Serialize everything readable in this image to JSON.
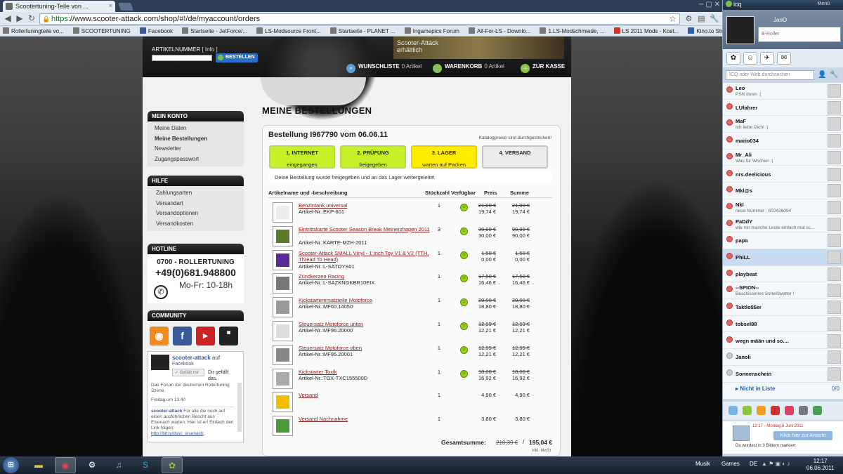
{
  "browser": {
    "tab_title": "Scootertuning-Teile von ...",
    "url_https": "https",
    "url_rest": "://www.scooter-attack.com/shop/#!/de/myaccount/orders",
    "bookmarks": [
      "Rollertuningteile vo...",
      "SCOOTERTUNING",
      "Facebook",
      "Startseite - JetForce/...",
      "LS-Modsource Front...",
      "Startseite - PLANET ...",
      "Ingamepics Forum",
      "All-For-LS - Downlo...",
      "1.LS-Modschmiede, ...",
      "LS 2011 Mods - Kost...",
      "Kino.to Stream Seite..."
    ]
  },
  "header": {
    "artikelnummer_label": "ARTIKELNUMMER",
    "info_label": "[ Info ]",
    "bestellen": "BESTELLEN",
    "banner_line1": "Scooter-Attack",
    "banner_line2": "erhältlich",
    "wishlist_label": "WUNSCHLISTE",
    "wishlist_count": "0 Artikel",
    "cart_label": "WARENKORB",
    "cart_count": "0 Artikel",
    "checkout": "ZUR KASSE"
  },
  "sidebar": {
    "account_head": "MEIN KONTO",
    "account_links": [
      "Meine Daten",
      "Meine Bestellungen",
      "Newsletter",
      "Zugangspasswort"
    ],
    "help_head": "HILFE",
    "help_links": [
      "Zahlungsarten",
      "Versandart",
      "Versandoptionen",
      "Versandkosten"
    ],
    "hotline_head": "HOTLINE",
    "hotline_name": "0700 - ROLLERTUNING",
    "hotline_phone": "+49(0)681.948800",
    "hotline_hours": "Mo-Fr: 10-18h",
    "community_head": "COMMUNITY",
    "fb_name": "scooter-attack",
    "fb_auf": "auf",
    "fb_facebook": "Facebook",
    "fb_like": "Gefällt mir",
    "fb_liked": "Dir gefällt das.",
    "fb_feed1": "Das Forum der deutschen Rollertuning Szene.",
    "fb_feed_time": "Freitag um 13:40",
    "fb_feed2_name": "scooter-attack",
    "fb_feed2": "Für alle die noch auf einen ausführlichen Bericht aus Eisenach warten: Hier ist er! Einfach den Link folgen:",
    "fb_feed_link": "http://bit.ly/dssc_eisenach"
  },
  "main": {
    "title": "MEINE BESTELLUNGEN",
    "order_title": "Bestellung I967790 vom 06.06.11",
    "catalog_note": "Katalogpreise sind durchgestrichen!",
    "steps": [
      {
        "title": "1. INTERNET",
        "status": "eingegangen"
      },
      {
        "title": "2. PRÜFUNG",
        "status": "freigegeben"
      },
      {
        "title": "3. LAGER",
        "status": "warten auf Packen"
      },
      {
        "title": "4. VERSAND",
        "status": ""
      }
    ],
    "status_text": "Deine Bestellung wurde freigegeben und an das Lager weitergeleitet",
    "columns": {
      "name": "Artikelname und -beschreibung",
      "qty": "Stückzahl",
      "avail": "Verfügbar",
      "price": "Preis",
      "sum": "Summe"
    },
    "items": [
      {
        "name": "Benzintank universal",
        "nr": "Artikel-Nr.:EKP-601",
        "qty": "1",
        "price_old": "21,00 €",
        "price": "19,74 €",
        "sum_old": "21,00 €",
        "sum": "19,74 €"
      },
      {
        "name": "Eintrittskarte Scooter Season Break Meinerzhagen 2011",
        "nr": "Artikel-Nr.:KARTE-MZH-2011",
        "qty": "3",
        "price_old": "30,00 €",
        "price": "30,00 €",
        "sum_old": "90,00 €",
        "sum": "90,00 €"
      },
      {
        "name": "Scooter-Attack SMALL Vinyl - 1 Inch Toy V1 & V2 (TTH, Thread To Head)",
        "nr": "Artikel-Nr.:L-SATOYS01",
        "qty": "1",
        "price_old": "1,50 €",
        "price": "0,00 €",
        "sum_old": "1,50 €",
        "sum": "0,00 €"
      },
      {
        "name": "Zündkerzen Racing",
        "nr": "Artikel-Nr.:L-SAZKNGKBR10EIX",
        "qty": "1",
        "price_old": "17,50 €",
        "price": "16,46 €",
        "sum_old": "17,50 €",
        "sum": "16,46 €"
      },
      {
        "name": "Kickstarterersatzteile Motoforce",
        "nr": "Artikel-Nr.:MF60.14050",
        "qty": "1",
        "price_old": "20,00 €",
        "price": "18,80 €",
        "sum_old": "20,00 €",
        "sum": "18,80 €"
      },
      {
        "name": "Steuersatz Motoforce unten",
        "nr": "Artikel-Nr.:MF96.20000",
        "qty": "1",
        "price_old": "12,99 €",
        "price": "12,21 €",
        "sum_old": "12,99 €",
        "sum": "12,21 €"
      },
      {
        "name": "Steuersatz Motoforce oben",
        "nr": "Artikel-Nr.:MF95.20001",
        "qty": "1",
        "price_old": "12,99 €",
        "price": "12,21 €",
        "sum_old": "12,99 €",
        "sum": "12,21 €"
      },
      {
        "name": "Kickstarter Toxik",
        "nr": "Artikel-Nr.:TOX-TXC155500D",
        "qty": "1",
        "price_old": "18,00 €",
        "price": "16,92 €",
        "sum_old": "18,00 €",
        "sum": "16,92 €"
      },
      {
        "name": "Versand",
        "nr": "",
        "qty": "1",
        "price_old": "",
        "price": "4,90 €",
        "sum_old": "",
        "sum": "4,90 €"
      },
      {
        "name": "Versand Nachnahme",
        "nr": "",
        "qty": "1",
        "price_old": "",
        "price": "3,80 €",
        "sum_old": "",
        "sum": "3,80 €"
      }
    ],
    "total_label": "Gesamtsumme:",
    "total_old": "210,39 €",
    "total_sep": "/",
    "total": "195,04 €",
    "total_note": "inkl. MwSt"
  },
  "icq": {
    "title": "icq",
    "menu": "Menü",
    "nick": "JanO",
    "status_msg": "B-Roller",
    "search_placeholder": "ICQ oder Web durchsuchen",
    "contacts": [
      {
        "name": "Leo",
        "status": "PSN down :("
      },
      {
        "name": "LUfahrer",
        "status": ""
      },
      {
        "name": "MaF",
        "status": "Ich liebe Dich! :)"
      },
      {
        "name": "mario034",
        "status": ""
      },
      {
        "name": "Mr_Ali",
        "status": "Was für Wochen :)"
      },
      {
        "name": "nrs.deelicious",
        "status": ""
      },
      {
        "name": "Mkl@s",
        "status": ""
      },
      {
        "name": "NkI",
        "status": "neue Nummer : 602436094"
      },
      {
        "name": "PaDdY",
        "status": "wie mir manche Leute einfach mal sc..."
      },
      {
        "name": "papa",
        "status": ""
      },
      {
        "name": "PhiLL",
        "status": ""
      },
      {
        "name": "playbeat",
        "status": ""
      },
      {
        "name": "--SPION--",
        "status": "Beschissenes Scheißwetter !"
      },
      {
        "name": "Taktlo$$er",
        "status": ""
      },
      {
        "name": "tobsel88",
        "status": ""
      },
      {
        "name": "wegn mään und so....",
        "status": ""
      },
      {
        "name": "Janoli",
        "status": ""
      },
      {
        "name": "Sonnenschein",
        "status": ""
      }
    ],
    "not_in_list": "Nicht in Liste",
    "not_in_list_count": "0/0",
    "news_date": "12:17 - Montag,6 Juni 2011",
    "news_btn": "Klick hier zur Ansicht",
    "news_text": "Du wurdest in 3 Bildern markiert"
  },
  "taskbar": {
    "musik": "Musik",
    "games": "Games",
    "lang": "DE",
    "time": "12:17",
    "date": "06.06.2011"
  }
}
